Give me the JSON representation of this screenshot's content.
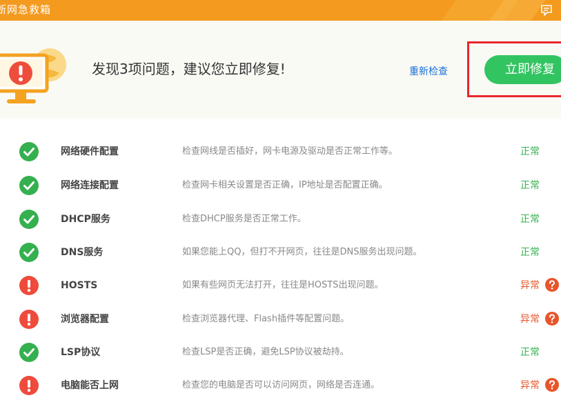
{
  "window": {
    "title": "断网急救箱",
    "feedback_icon": "feedback-icon"
  },
  "header": {
    "headline": "发现3项问题，建议您立即修复!",
    "recheck_label": "重新检查",
    "fix_button_label": "立即修复",
    "status_icon": "warning-monitor-icon"
  },
  "colors": {
    "titlebar": "#f39a1f",
    "header_bg": "#fafaf5",
    "fix_button": "#33c462",
    "ok": "#35b04f",
    "error": "#e8552a",
    "highlight_box": "#e8262a",
    "link": "#1a6fd6"
  },
  "checks": [
    {
      "name": "网络硬件配置",
      "description": "检查网线是否插好，网卡电源及驱动是否正常工作等。",
      "result": "正常",
      "status": "ok"
    },
    {
      "name": "网络连接配置",
      "description": "检查网卡相关设置是否正确，IP地址是否配置正确。",
      "result": "正常",
      "status": "ok"
    },
    {
      "name": "DHCP服务",
      "description": "检查DHCP服务是否正常工作。",
      "result": "正常",
      "status": "ok"
    },
    {
      "name": "DNS服务",
      "description": "如果您能上QQ，但打不开网页，往往是DNS服务出现问题。",
      "result": "正常",
      "status": "ok"
    },
    {
      "name": "HOSTS",
      "description": "如果有些网页无法打开，往往是HOSTS出现问题。",
      "result": "异常",
      "status": "error"
    },
    {
      "name": "浏览器配置",
      "description": "检查浏览器代理、Flash插件等配置问题。",
      "result": "异常",
      "status": "error"
    },
    {
      "name": "LSP协议",
      "description": "检查LSP是否正确，避免LSP协议被劫持。",
      "result": "正常",
      "status": "ok"
    },
    {
      "name": "电脑能否上网",
      "description": "检查您的电脑是否可以访问网页，网络是否连通。",
      "result": "异常",
      "status": "error"
    }
  ]
}
